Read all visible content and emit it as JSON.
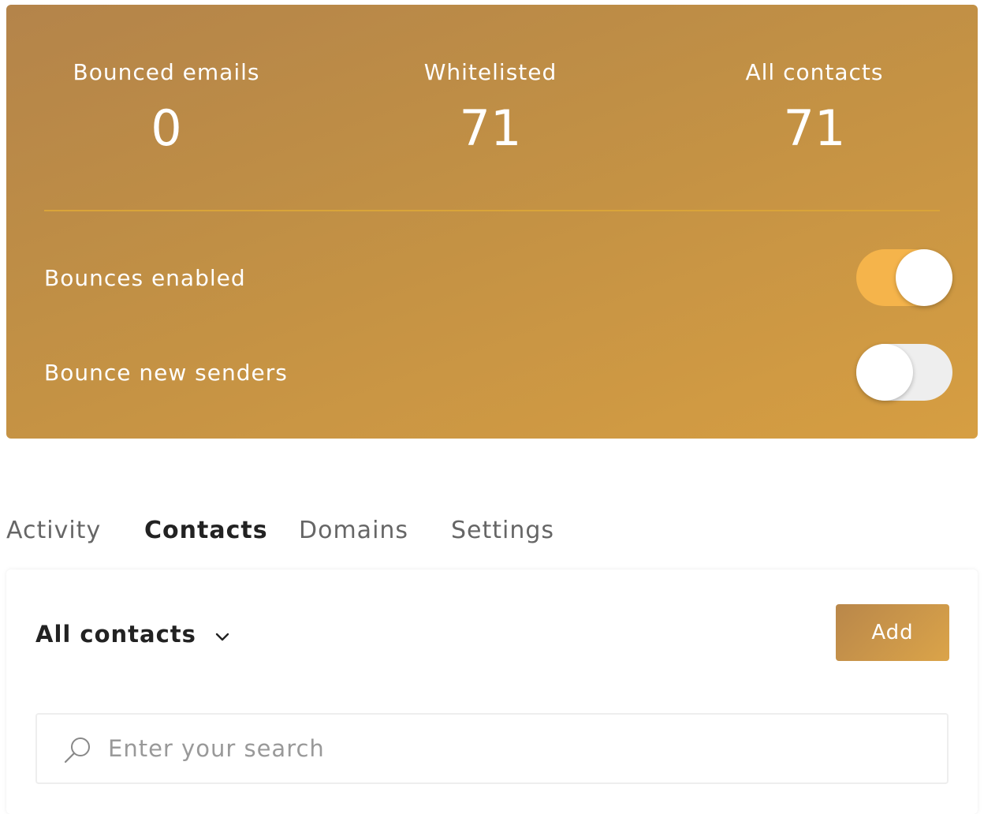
{
  "stats": [
    {
      "label": "Bounced emails",
      "value": "0"
    },
    {
      "label": "Whitelisted",
      "value": "71"
    },
    {
      "label": "All contacts",
      "value": "71"
    }
  ],
  "toggles": [
    {
      "label": "Bounces enabled",
      "enabled": true
    },
    {
      "label": "Bounce new senders",
      "enabled": false
    }
  ],
  "tabs": [
    {
      "label": "Activity",
      "active": false
    },
    {
      "label": "Contacts",
      "active": true
    },
    {
      "label": "Domains",
      "active": false
    },
    {
      "label": "Settings",
      "active": false
    }
  ],
  "contacts_panel": {
    "filter_label": "All contacts",
    "filter_icon": "chevron-down-icon",
    "add_label": "Add",
    "search_placeholder": "Enter your search",
    "search_value": "",
    "search_icon": "search-icon"
  },
  "colors": {
    "card_gradient_start": "#b4844a",
    "card_gradient_end": "#d69e42",
    "toggle_on": "#f5b44b",
    "toggle_off": "#eeeeee",
    "divider": "#d9a43a"
  }
}
